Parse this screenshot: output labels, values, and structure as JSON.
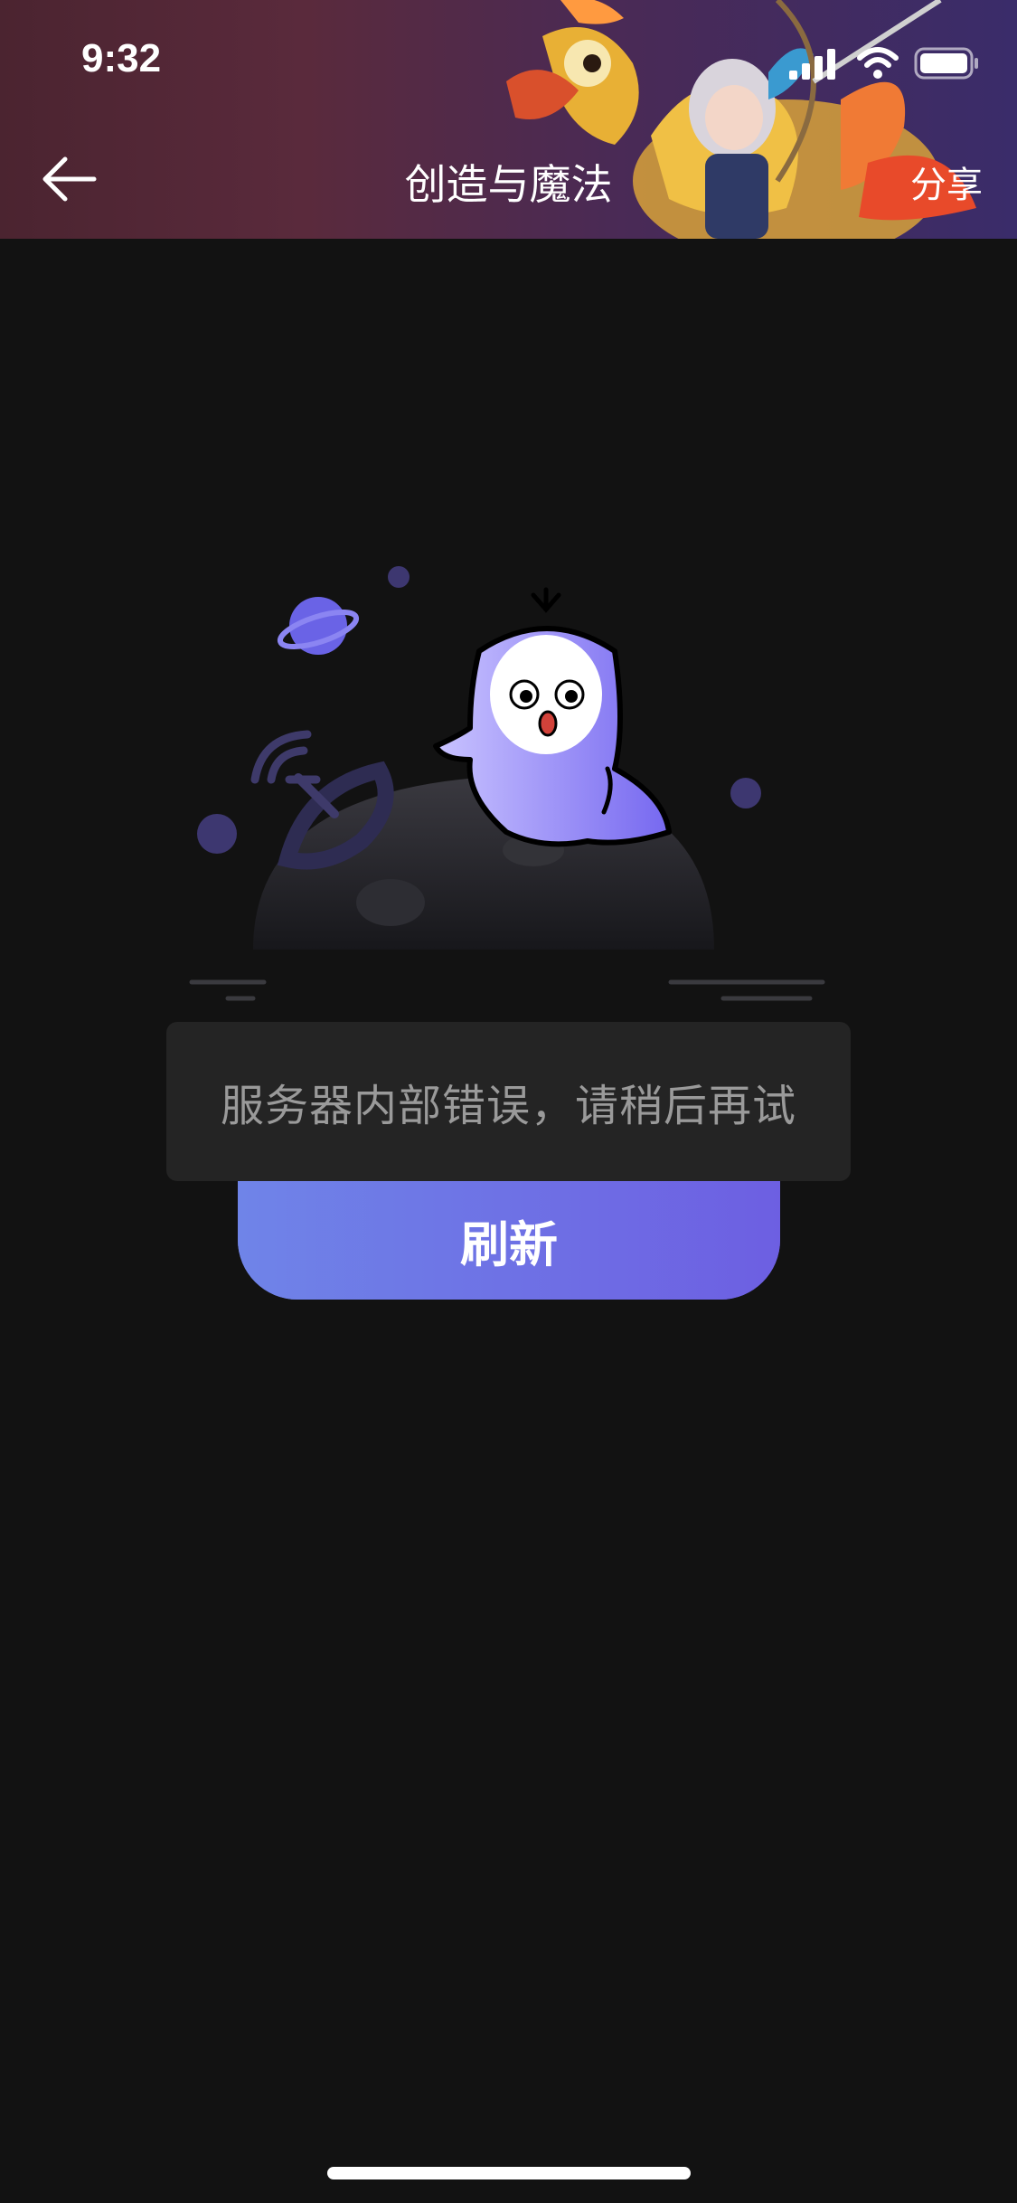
{
  "status_bar": {
    "time": "9:32"
  },
  "nav": {
    "title": "创造与魔法",
    "share_label": "分享"
  },
  "error": {
    "message": "服务器内部错误，请稍后再试"
  },
  "refresh_button": {
    "label": "刷新"
  },
  "colors": {
    "background": "#121212",
    "accent_start": "#6f84e8",
    "accent_end": "#6d5fe2",
    "error_box": "#242424"
  },
  "icons": [
    "back-arrow-icon",
    "signal-icon",
    "wifi-icon",
    "battery-icon"
  ]
}
